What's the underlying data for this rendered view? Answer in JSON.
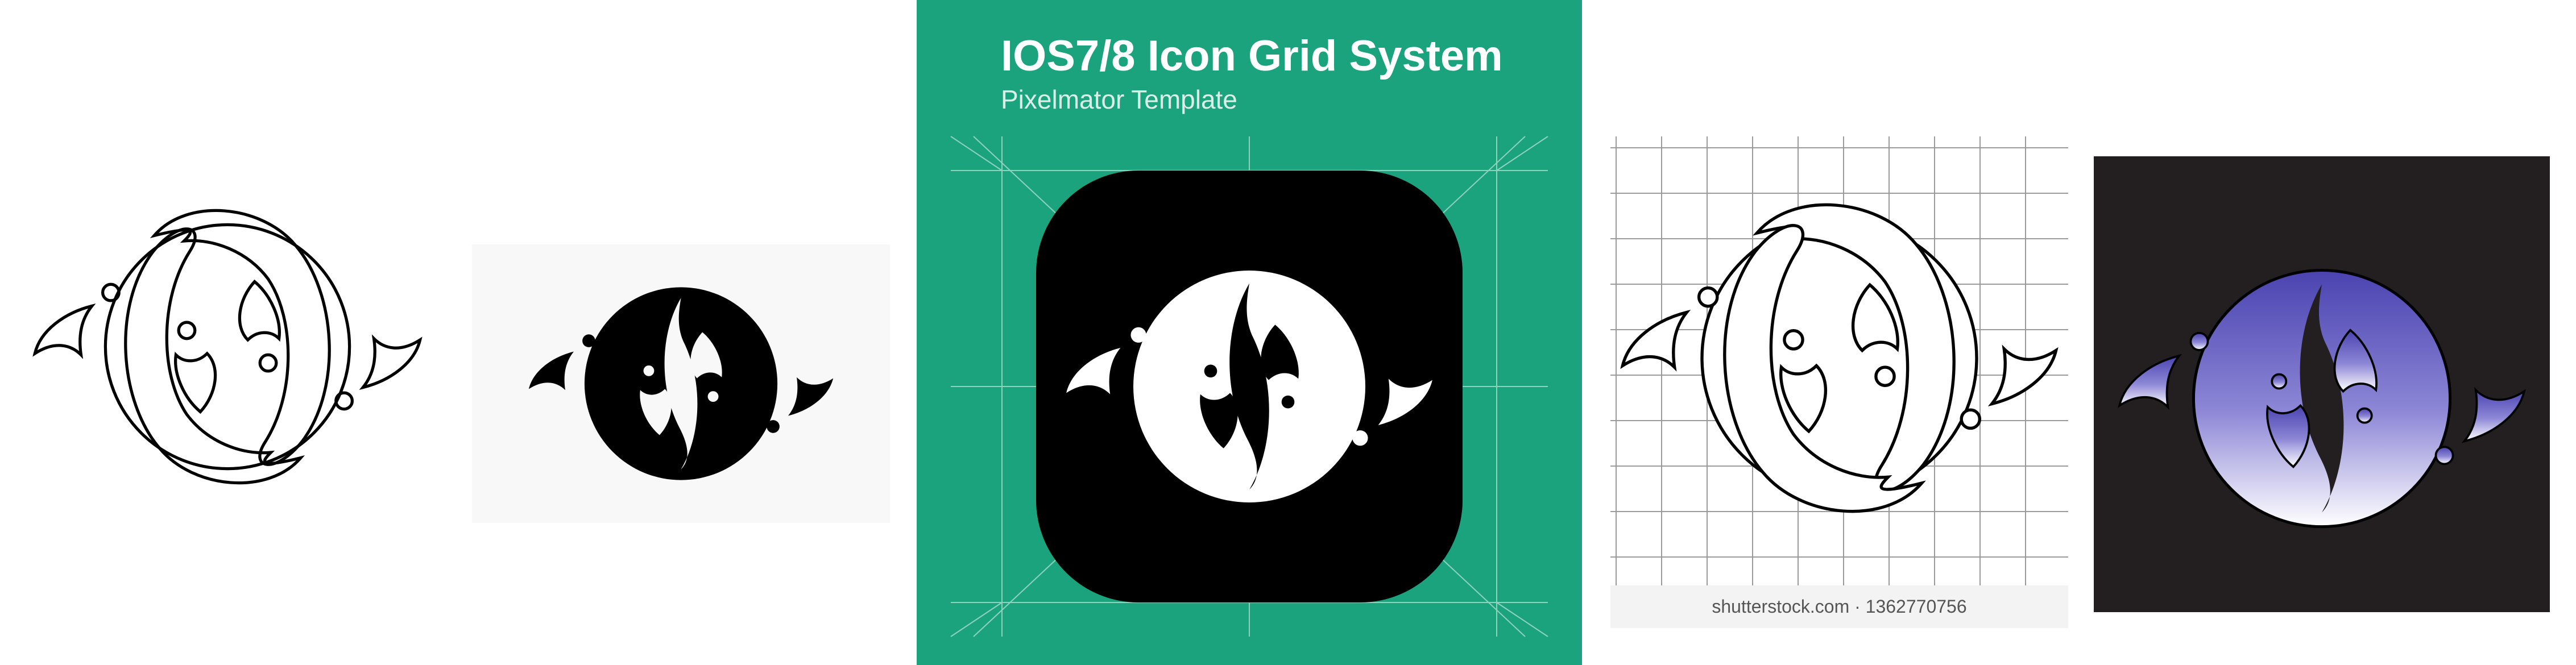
{
  "template": {
    "title": "IOS7/8 Icon Grid System",
    "subtitle": "Pixelmator Template"
  },
  "stock": {
    "watermark": "shutterstock.com · 1362770756"
  },
  "icons": {
    "panel_outline": "fish-circle-outline-icon",
    "panel_filled": "fish-circle-filled-icon",
    "panel_app": "fish-circle-app-icon",
    "panel_grid": "fish-circle-grid-icon",
    "panel_gradient": "fish-circle-gradient-icon"
  },
  "colors": {
    "template_bg": "#1ba37e",
    "app_tile": "#000000",
    "dark_bg": "#231f20",
    "gradient_top": "#4a43b0",
    "gradient_bottom": "#ffffff"
  }
}
